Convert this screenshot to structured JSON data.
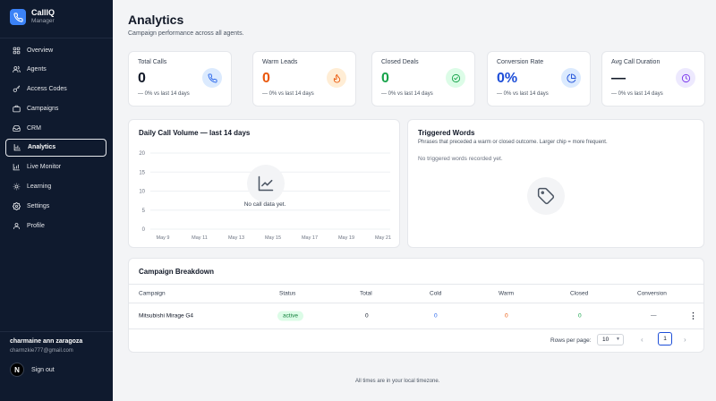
{
  "brand": {
    "name": "CallIQ",
    "role": "Manager"
  },
  "nav": [
    {
      "id": "overview",
      "label": "Overview",
      "icon": "grid-icon",
      "active": false
    },
    {
      "id": "agents",
      "label": "Agents",
      "icon": "users-icon",
      "active": false
    },
    {
      "id": "access-codes",
      "label": "Access Codes",
      "icon": "key-icon",
      "active": false
    },
    {
      "id": "campaigns",
      "label": "Campaigns",
      "icon": "briefcase-icon",
      "active": false
    },
    {
      "id": "crm",
      "label": "CRM",
      "icon": "inbox-icon",
      "active": false
    },
    {
      "id": "analytics",
      "label": "Analytics",
      "icon": "bar-chart-icon",
      "active": true
    },
    {
      "id": "live-monitor",
      "label": "Live Monitor",
      "icon": "monitor-icon",
      "active": false
    },
    {
      "id": "learning",
      "label": "Learning",
      "icon": "lightbulb-icon",
      "active": false
    },
    {
      "id": "settings",
      "label": "Settings",
      "icon": "gear-icon",
      "active": false
    },
    {
      "id": "profile",
      "label": "Profile",
      "icon": "user-icon",
      "active": false
    }
  ],
  "user": {
    "name": "charmaine ann zaragoza",
    "email": "charmzkie777@gmail.com",
    "signout_label": "Sign out",
    "avatar_letter": "N"
  },
  "header": {
    "title": "Analytics",
    "subtitle": "Campaign performance across all agents."
  },
  "stats": [
    {
      "label": "Total Calls",
      "value": "0",
      "delta": "— 0% vs last 14 days",
      "color": "#111827",
      "icon_bg": "#dbeafe",
      "icon_color": "#2563eb",
      "icon": "phone-icon"
    },
    {
      "label": "Warm Leads",
      "value": "0",
      "delta": "— 0% vs last 14 days",
      "color": "#ea580c",
      "icon_bg": "#ffedd5",
      "icon_color": "#ea580c",
      "icon": "flame-icon"
    },
    {
      "label": "Closed Deals",
      "value": "0",
      "delta": "— 0% vs last 14 days",
      "color": "#16a34a",
      "icon_bg": "#dcfce7",
      "icon_color": "#16a34a",
      "icon": "check-circle-icon"
    },
    {
      "label": "Conversion Rate",
      "value": "0%",
      "delta": "— 0% vs last 14 days",
      "color": "#1d4ed8",
      "icon_bg": "#dbeafe",
      "icon_color": "#1d4ed8",
      "icon": "pie-chart-icon"
    },
    {
      "label": "Avg Call Duration",
      "value": "—",
      "delta": "— 0% vs last 14 days",
      "color": "#111827",
      "icon_bg": "#ede9fe",
      "icon_color": "#7c3aed",
      "icon": "clock-icon"
    }
  ],
  "daily_chart": {
    "title": "Daily Call Volume — last 14 days",
    "empty_text": "No call data yet."
  },
  "chart_data": {
    "type": "line",
    "title": "Daily Call Volume — last 14 days",
    "x": [
      "May 9",
      "May 11",
      "May 13",
      "May 15",
      "May 17",
      "May 19",
      "May 21"
    ],
    "y_ticks": [
      "20",
      "15",
      "10",
      "5",
      "0"
    ],
    "ylim": [
      0,
      20
    ],
    "series": [],
    "grid": true
  },
  "triggered": {
    "title": "Triggered Words",
    "description": "Phrases that preceded a warm or closed outcome. Larger chip = more frequent.",
    "empty_text": "No triggered words recorded yet."
  },
  "breakdown": {
    "title": "Campaign Breakdown",
    "columns": [
      "Campaign",
      "Status",
      "Total",
      "Cold",
      "Warm",
      "Closed",
      "Conversion"
    ],
    "rows": [
      {
        "campaign": "Mitsubishi Mirage G4",
        "status": "active",
        "total": "0",
        "cold": "0",
        "warm": "0",
        "closed": "0",
        "conversion": "—"
      }
    ],
    "rows_per_page_label": "Rows per page:",
    "rows_per_page": "10",
    "current_page": "1",
    "colors": {
      "cold": "#2563eb",
      "warm": "#ea580c",
      "closed": "#16a34a"
    }
  },
  "footer": {
    "note": "All times are in your local timezone."
  }
}
